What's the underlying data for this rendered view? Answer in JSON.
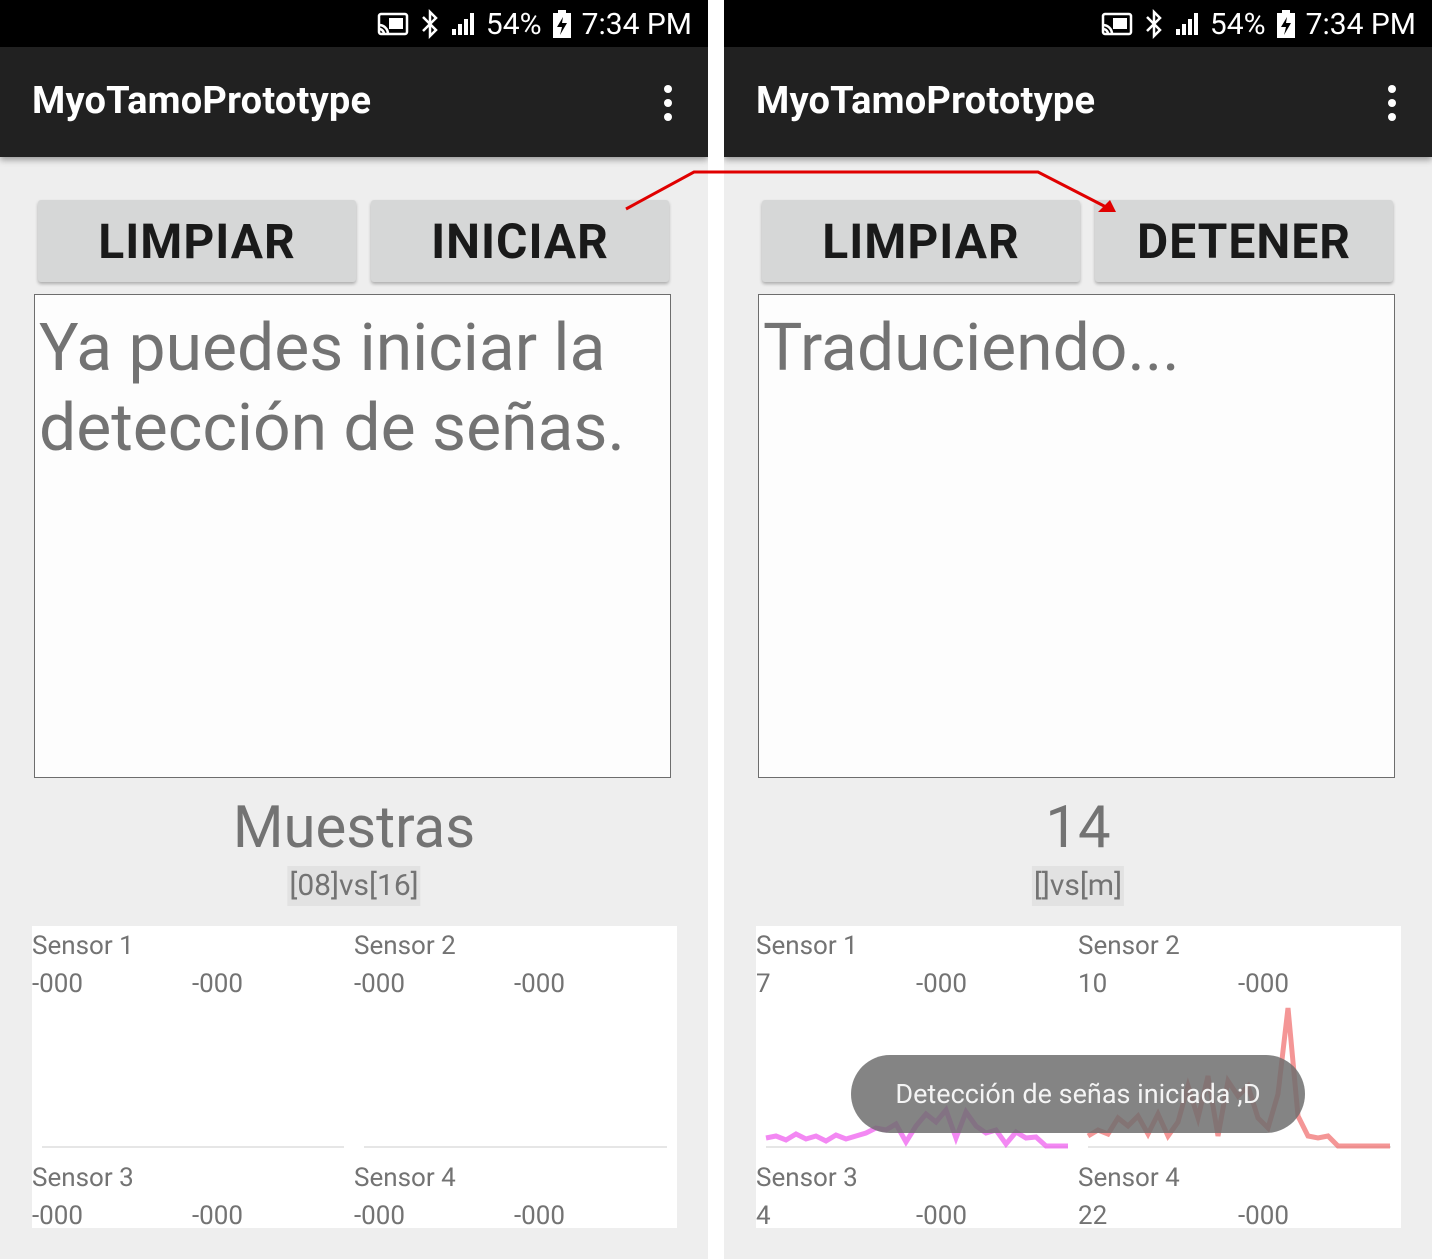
{
  "colors": {
    "statusbar": "#000000",
    "appbar": "#212121",
    "background": "#eeeeee",
    "button": "#d6d7d7",
    "text_gray": "#737373",
    "arrow": "#e00000",
    "graph_sensor1": "#ee55ee",
    "graph_sensor2": "#f06a6a"
  },
  "screens": [
    {
      "status": {
        "battery": "54%",
        "time": "7:34 PM"
      },
      "app_title": "MyoTamoPrototype",
      "buttons": {
        "clear": "LIMPIAR",
        "toggle": "INICIAR"
      },
      "output_text": "Ya puedes iniciar la detección de señas.",
      "samples_label": "Muestras",
      "comparison": "[08]vs[16]",
      "sensors": [
        {
          "title": "Sensor 1",
          "value_a": "-000",
          "value_b": "-000"
        },
        {
          "title": "Sensor 2",
          "value_a": "-000",
          "value_b": "-000"
        },
        {
          "title": "Sensor 3",
          "value_a": "-000",
          "value_b": "-000"
        },
        {
          "title": "Sensor 4",
          "value_a": "-000",
          "value_b": "-000"
        }
      ]
    },
    {
      "status": {
        "battery": "54%",
        "time": "7:34 PM"
      },
      "app_title": "MyoTamoPrototype",
      "buttons": {
        "clear": "LIMPIAR",
        "toggle": "DETENER"
      },
      "output_text": "Traduciendo...",
      "samples_label": "14",
      "comparison": "[]vs[m]",
      "sensors": [
        {
          "title": "Sensor 1",
          "value_a": "7",
          "value_b": "-000"
        },
        {
          "title": "Sensor 2",
          "value_a": "10",
          "value_b": "-000"
        },
        {
          "title": "Sensor 3",
          "value_a": "4",
          "value_b": "-000"
        },
        {
          "title": "Sensor 4",
          "value_a": "22",
          "value_b": "-000"
        }
      ],
      "toast": "Detección de señas iniciada ;D"
    }
  ]
}
